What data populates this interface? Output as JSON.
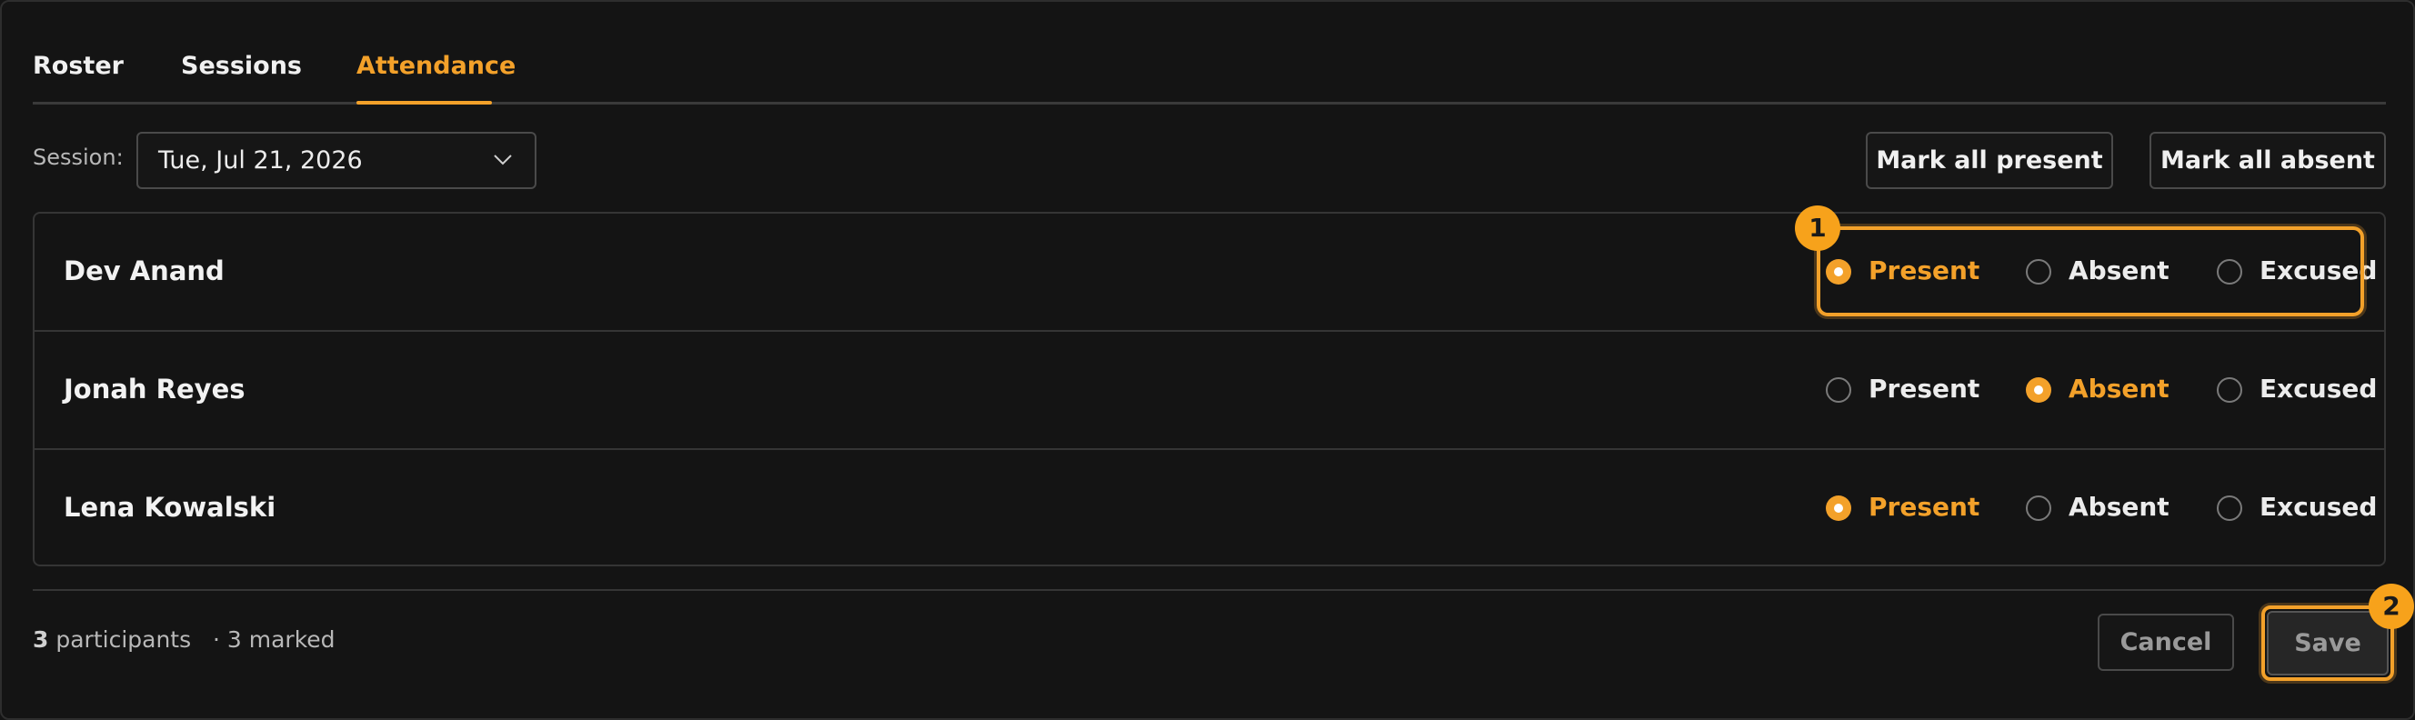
{
  "tabs": [
    {
      "label": "Roster",
      "active": false
    },
    {
      "label": "Sessions",
      "active": false
    },
    {
      "label": "Attendance",
      "active": true
    }
  ],
  "session": {
    "label": "Session:",
    "selected": "Tue, Jul 21, 2026"
  },
  "actions": {
    "mark_all_present": "Mark all present",
    "mark_all_absent": "Mark all absent"
  },
  "options": {
    "present": "Present",
    "absent": "Absent",
    "excused": "Excused"
  },
  "participants": [
    {
      "name": "Dev Anand",
      "status": "present"
    },
    {
      "name": "Jonah Reyes",
      "status": "absent"
    },
    {
      "name": "Lena Kowalski",
      "status": "present"
    }
  ],
  "footer": {
    "participant_count": "3",
    "participants_word": "participants",
    "separator": "·",
    "marked": "3 marked",
    "cancel_label": "Cancel",
    "save_label": "Save"
  },
  "markers": [
    "1",
    "2"
  ],
  "colors": {
    "accent": "#f3a12a",
    "background": "#141414",
    "border": "#353535"
  }
}
